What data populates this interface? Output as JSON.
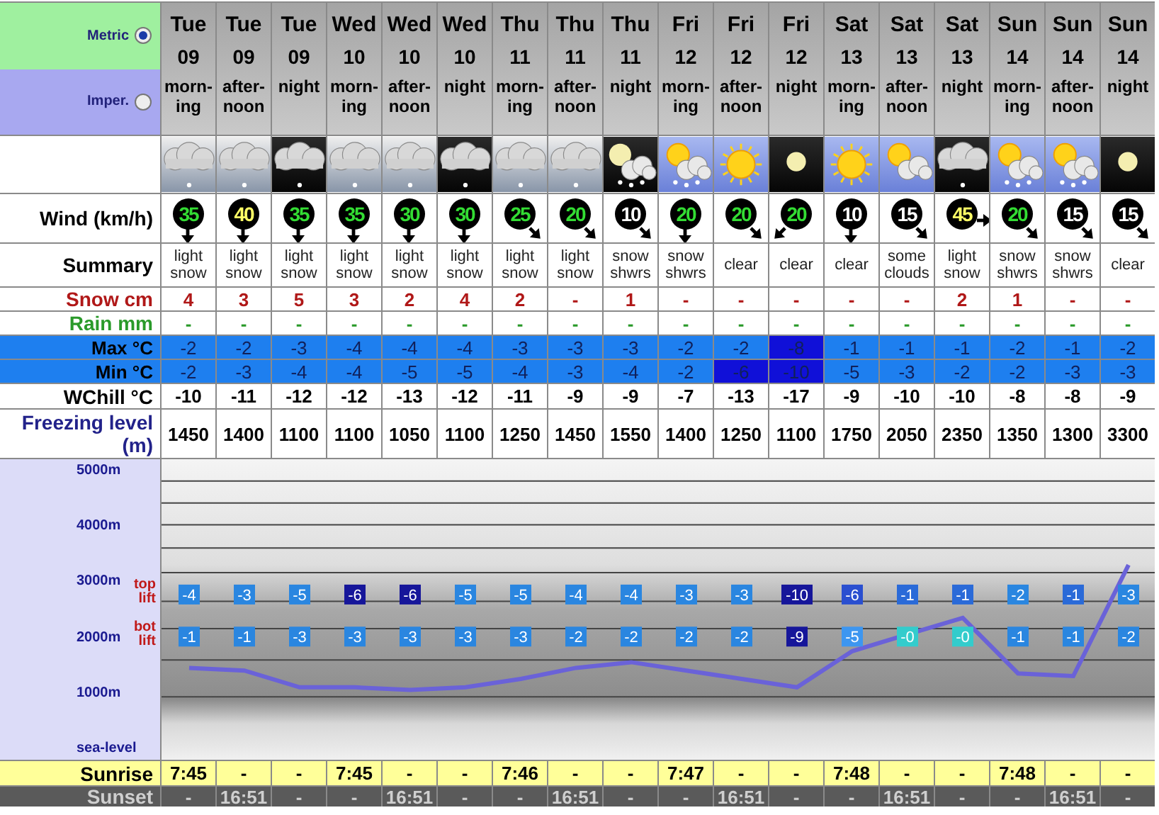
{
  "units": [
    {
      "label": "Metric",
      "selected": true
    },
    {
      "label": "Imper.",
      "selected": false
    }
  ],
  "row_labels": {
    "wind": "Wind (km/h)",
    "summary": "Summary",
    "snow": "Snow cm",
    "rain": "Rain mm",
    "max": "Max °C",
    "min": "Min °C",
    "wchill": "WChill °C",
    "freezing": "Freezing level (m)",
    "sunrise": "Sunrise",
    "sunset": "Sunset"
  },
  "columns": [
    {
      "day": "Tue",
      "date": "09",
      "period": "morn-ing",
      "icon": {
        "kind": "cloud-snow"
      },
      "wind": {
        "speed": "35",
        "color": "#33dd33",
        "kind": "s"
      },
      "summary": "light snow",
      "snow": "4",
      "rain": "-",
      "max": {
        "value": "-2",
        "highlight": false
      },
      "min": {
        "value": "-2",
        "highlight": false
      },
      "wchill": "-10",
      "freezing": "1450",
      "sunrise": "7:45",
      "sunset": "-"
    },
    {
      "day": "Tue",
      "date": "09",
      "period": "after-noon",
      "icon": {
        "kind": "cloud-snow"
      },
      "wind": {
        "speed": "40",
        "color": "#ffff66",
        "kind": "s"
      },
      "summary": "light snow",
      "snow": "3",
      "rain": "-",
      "max": {
        "value": "-2",
        "highlight": false
      },
      "min": {
        "value": "-3",
        "highlight": false
      },
      "wchill": "-11",
      "freezing": "1400",
      "sunrise": "-",
      "sunset": "16:51"
    },
    {
      "day": "Tue",
      "date": "09",
      "period": "night",
      "icon": {
        "kind": "cloud-snow-night"
      },
      "wind": {
        "speed": "35",
        "color": "#33dd33",
        "kind": "s"
      },
      "summary": "light snow",
      "snow": "5",
      "rain": "-",
      "max": {
        "value": "-3",
        "highlight": false
      },
      "min": {
        "value": "-4",
        "highlight": false
      },
      "wchill": "-12",
      "freezing": "1100",
      "sunrise": "-",
      "sunset": "-"
    },
    {
      "day": "Wed",
      "date": "10",
      "period": "morn-ing",
      "icon": {
        "kind": "cloud-snow"
      },
      "wind": {
        "speed": "35",
        "color": "#33dd33",
        "kind": "s"
      },
      "summary": "light snow",
      "snow": "3",
      "rain": "-",
      "max": {
        "value": "-4",
        "highlight": false
      },
      "min": {
        "value": "-4",
        "highlight": false
      },
      "wchill": "-12",
      "freezing": "1100",
      "sunrise": "7:45",
      "sunset": "-"
    },
    {
      "day": "Wed",
      "date": "10",
      "period": "after-noon",
      "icon": {
        "kind": "cloud-snow"
      },
      "wind": {
        "speed": "30",
        "color": "#33dd33",
        "kind": "s"
      },
      "summary": "light snow",
      "snow": "2",
      "rain": "-",
      "max": {
        "value": "-4",
        "highlight": false
      },
      "min": {
        "value": "-5",
        "highlight": false
      },
      "wchill": "-13",
      "freezing": "1050",
      "sunrise": "-",
      "sunset": "16:51"
    },
    {
      "day": "Wed",
      "date": "10",
      "period": "night",
      "icon": {
        "kind": "cloud-snow-night"
      },
      "wind": {
        "speed": "30",
        "color": "#33dd33",
        "kind": "s"
      },
      "summary": "light snow",
      "snow": "4",
      "rain": "-",
      "max": {
        "value": "-4",
        "highlight": false
      },
      "min": {
        "value": "-5",
        "highlight": false
      },
      "wchill": "-12",
      "freezing": "1100",
      "sunrise": "-",
      "sunset": "-"
    },
    {
      "day": "Thu",
      "date": "11",
      "period": "morn-ing",
      "icon": {
        "kind": "cloud-snow"
      },
      "wind": {
        "speed": "25",
        "color": "#33dd33",
        "kind": "se"
      },
      "summary": "light snow",
      "snow": "2",
      "rain": "-",
      "max": {
        "value": "-3",
        "highlight": false
      },
      "min": {
        "value": "-4",
        "highlight": false
      },
      "wchill": "-11",
      "freezing": "1250",
      "sunrise": "7:46",
      "sunset": "-"
    },
    {
      "day": "Thu",
      "date": "11",
      "period": "after-noon",
      "icon": {
        "kind": "cloud-snow"
      },
      "wind": {
        "speed": "20",
        "color": "#33dd33",
        "kind": "se"
      },
      "summary": "light snow",
      "snow": "-",
      "rain": "-",
      "max": {
        "value": "-3",
        "highlight": false
      },
      "min": {
        "value": "-3",
        "highlight": false
      },
      "wchill": "-9",
      "freezing": "1450",
      "sunrise": "-",
      "sunset": "16:51"
    },
    {
      "day": "Thu",
      "date": "11",
      "period": "night",
      "icon": {
        "kind": "moon-cloud-snow"
      },
      "wind": {
        "speed": "10",
        "color": "#ffffff",
        "kind": "se"
      },
      "summary": "snow shwrs",
      "snow": "1",
      "rain": "-",
      "max": {
        "value": "-3",
        "highlight": false
      },
      "min": {
        "value": "-4",
        "highlight": false
      },
      "wchill": "-9",
      "freezing": "1550",
      "sunrise": "-",
      "sunset": "-"
    },
    {
      "day": "Fri",
      "date": "12",
      "period": "morn-ing",
      "icon": {
        "kind": "sun-cloud-snow"
      },
      "wind": {
        "speed": "20",
        "color": "#33dd33",
        "kind": "s"
      },
      "summary": "snow shwrs",
      "snow": "-",
      "rain": "-",
      "max": {
        "value": "-2",
        "highlight": false
      },
      "min": {
        "value": "-2",
        "highlight": false
      },
      "wchill": "-7",
      "freezing": "1400",
      "sunrise": "7:47",
      "sunset": "-"
    },
    {
      "day": "Fri",
      "date": "12",
      "period": "after-noon",
      "icon": {
        "kind": "sun"
      },
      "wind": {
        "speed": "20",
        "color": "#33dd33",
        "kind": "se"
      },
      "summary": "clear",
      "snow": "-",
      "rain": "-",
      "max": {
        "value": "-2",
        "highlight": false
      },
      "min": {
        "value": "-6",
        "highlight": true
      },
      "wchill": "-13",
      "freezing": "1250",
      "sunrise": "-",
      "sunset": "16:51"
    },
    {
      "day": "Fri",
      "date": "12",
      "period": "night",
      "icon": {
        "kind": "moon"
      },
      "wind": {
        "speed": "20",
        "color": "#33dd33",
        "kind": "sw"
      },
      "summary": "clear",
      "snow": "-",
      "rain": "-",
      "max": {
        "value": "-8",
        "highlight": true
      },
      "min": {
        "value": "-10",
        "highlight": true
      },
      "wchill": "-17",
      "freezing": "1100",
      "sunrise": "-",
      "sunset": "-"
    },
    {
      "day": "Sat",
      "date": "13",
      "period": "morn-ing",
      "icon": {
        "kind": "sun"
      },
      "wind": {
        "speed": "10",
        "color": "#ffffff",
        "kind": "s"
      },
      "summary": "clear",
      "snow": "-",
      "rain": "-",
      "max": {
        "value": "-1",
        "highlight": false
      },
      "min": {
        "value": "-5",
        "highlight": false
      },
      "wchill": "-9",
      "freezing": "1750",
      "sunrise": "7:48",
      "sunset": "-"
    },
    {
      "day": "Sat",
      "date": "13",
      "period": "after-noon",
      "icon": {
        "kind": "sun-cloud"
      },
      "wind": {
        "speed": "15",
        "color": "#ffffff",
        "kind": "se"
      },
      "summary": "some clouds",
      "snow": "-",
      "rain": "-",
      "max": {
        "value": "-1",
        "highlight": false
      },
      "min": {
        "value": "-3",
        "highlight": false
      },
      "wchill": "-10",
      "freezing": "2050",
      "sunrise": "-",
      "sunset": "16:51"
    },
    {
      "day": "Sat",
      "date": "13",
      "period": "night",
      "icon": {
        "kind": "cloud-snow-night"
      },
      "wind": {
        "speed": "45",
        "color": "#ffff66",
        "kind": "e"
      },
      "summary": "light snow",
      "snow": "2",
      "rain": "-",
      "max": {
        "value": "-1",
        "highlight": false
      },
      "min": {
        "value": "-2",
        "highlight": false
      },
      "wchill": "-10",
      "freezing": "2350",
      "sunrise": "-",
      "sunset": "-"
    },
    {
      "day": "Sun",
      "date": "14",
      "period": "morn-ing",
      "icon": {
        "kind": "sun-cloud-snow"
      },
      "wind": {
        "speed": "20",
        "color": "#33dd33",
        "kind": "se"
      },
      "summary": "snow shwrs",
      "snow": "1",
      "rain": "-",
      "max": {
        "value": "-2",
        "highlight": false
      },
      "min": {
        "value": "-2",
        "highlight": false
      },
      "wchill": "-8",
      "freezing": "1350",
      "sunrise": "7:48",
      "sunset": "-"
    },
    {
      "day": "Sun",
      "date": "14",
      "period": "after-noon",
      "icon": {
        "kind": "sun-cloud-snow"
      },
      "wind": {
        "speed": "15",
        "color": "#ffffff",
        "kind": "se"
      },
      "summary": "snow shwrs",
      "snow": "-",
      "rain": "-",
      "max": {
        "value": "-1",
        "highlight": false
      },
      "min": {
        "value": "-3",
        "highlight": false
      },
      "wchill": "-8",
      "freezing": "1300",
      "sunrise": "-",
      "sunset": "16:51"
    },
    {
      "day": "Sun",
      "date": "14",
      "period": "night",
      "icon": {
        "kind": "moon"
      },
      "wind": {
        "speed": "15",
        "color": "#ffffff",
        "kind": "se"
      },
      "summary": "clear",
      "snow": "-",
      "rain": "-",
      "max": {
        "value": "-2",
        "highlight": false
      },
      "min": {
        "value": "-3",
        "highlight": false
      },
      "wchill": "-9",
      "freezing": "3300",
      "sunrise": "-",
      "sunset": "-"
    }
  ],
  "chart": {
    "lifts": [
      {
        "label": "top lift",
        "temps": [
          {
            "value": "-4",
            "color": "#2a86e0"
          },
          {
            "value": "-3",
            "color": "#2a86e0"
          },
          {
            "value": "-5",
            "color": "#2a86e0"
          },
          {
            "value": "-6",
            "color": "#16169a"
          },
          {
            "value": "-6",
            "color": "#16169a"
          },
          {
            "value": "-5",
            "color": "#2a86e0"
          },
          {
            "value": "-5",
            "color": "#2a86e0"
          },
          {
            "value": "-4",
            "color": "#2a86e0"
          },
          {
            "value": "-4",
            "color": "#2a86e0"
          },
          {
            "value": "-3",
            "color": "#2a86e0"
          },
          {
            "value": "-3",
            "color": "#2a86e0"
          },
          {
            "value": "-10",
            "color": "#16169a"
          },
          {
            "value": "-6",
            "color": "#2a4fd0"
          },
          {
            "value": "-1",
            "color": "#2a6ad8"
          },
          {
            "value": "-1",
            "color": "#2a6ad8"
          },
          {
            "value": "-2",
            "color": "#2a86e0"
          },
          {
            "value": "-1",
            "color": "#2a6ad8"
          },
          {
            "value": "-3",
            "color": "#2a86e0"
          }
        ]
      },
      {
        "label": "bot lift",
        "temps": [
          {
            "value": "-1",
            "color": "#2a86e0"
          },
          {
            "value": "-1",
            "color": "#2a86e0"
          },
          {
            "value": "-3",
            "color": "#2a86e0"
          },
          {
            "value": "-3",
            "color": "#2a86e0"
          },
          {
            "value": "-3",
            "color": "#2a86e0"
          },
          {
            "value": "-3",
            "color": "#2a86e0"
          },
          {
            "value": "-3",
            "color": "#2a86e0"
          },
          {
            "value": "-2",
            "color": "#2a86e0"
          },
          {
            "value": "-2",
            "color": "#2a86e0"
          },
          {
            "value": "-2",
            "color": "#2a86e0"
          },
          {
            "value": "-2",
            "color": "#2a86e0"
          },
          {
            "value": "-9",
            "color": "#16169a"
          },
          {
            "value": "-5",
            "color": "#3d96f0"
          },
          {
            "value": "-0",
            "color": "#33cccc"
          },
          {
            "value": "-0",
            "color": "#33cccc"
          },
          {
            "value": "-1",
            "color": "#2a86e0"
          },
          {
            "value": "-1",
            "color": "#2a86e0"
          },
          {
            "value": "-2",
            "color": "#2a86e0"
          }
        ]
      }
    ],
    "chart_data": {
      "type": "line",
      "ylim": [
        -204,
        5204
      ],
      "yticks": [
        {
          "value": 5000,
          "label": "5000m"
        },
        {
          "value": 4000,
          "label": "4000m"
        },
        {
          "value": 3000,
          "label": "3000m"
        },
        {
          "value": 2000,
          "label": "2000m"
        },
        {
          "value": 1000,
          "label": "1000m"
        },
        {
          "value": 0,
          "label": "sea-level"
        }
      ],
      "series": [
        {
          "color": "#6a62d8",
          "values": [
            1450,
            1400,
            1100,
            1100,
            1050,
            1100,
            1250,
            1450,
            1550,
            1400,
            1250,
            1100,
            1750,
            2050,
            2350,
            1350,
            1300,
            3300
          ]
        }
      ]
    }
  }
}
